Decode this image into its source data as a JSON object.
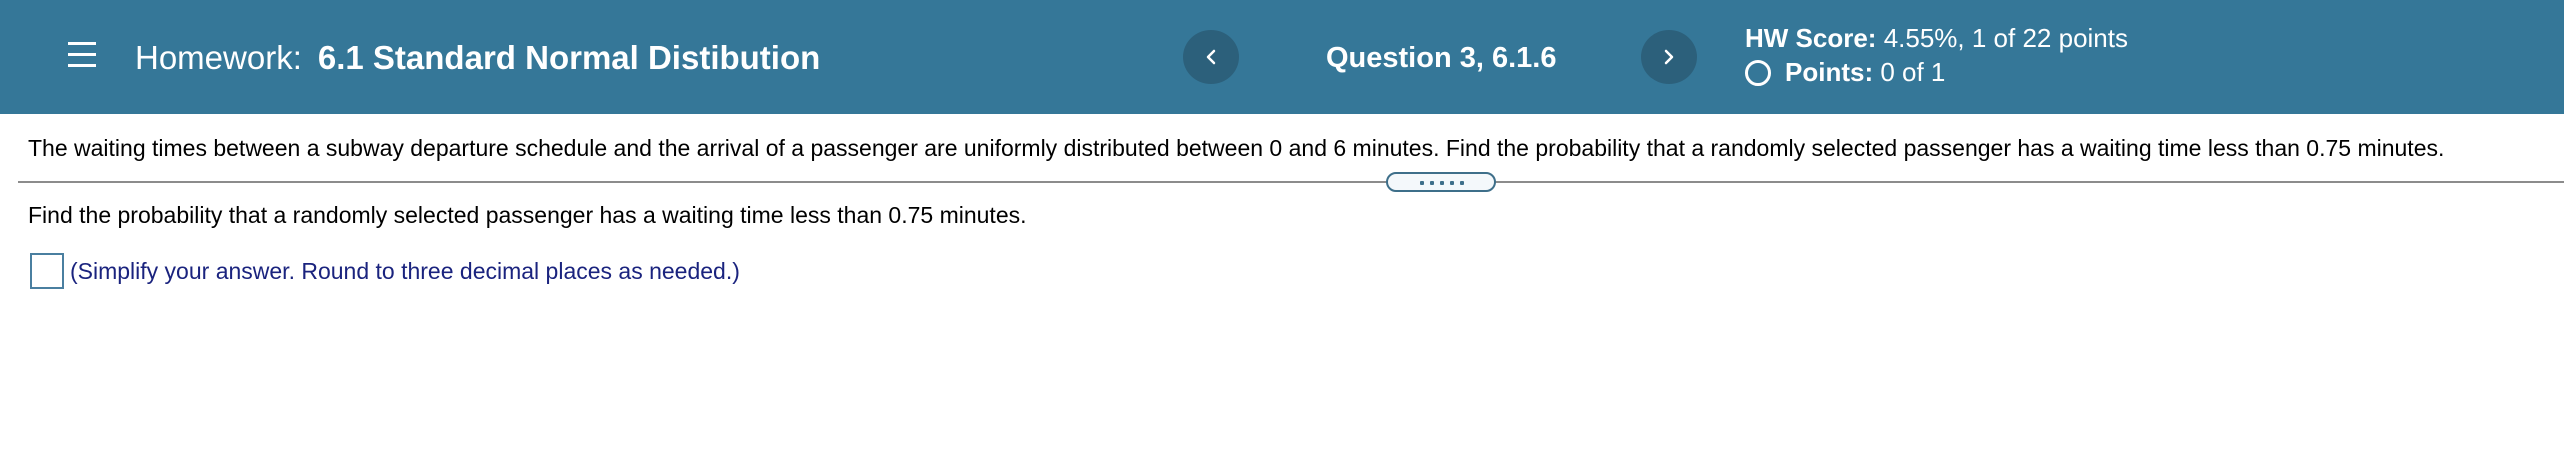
{
  "header": {
    "homework_prefix": "Homework:",
    "homework_name": "6.1 Standard Normal Distibution",
    "question_label": "Question 3, 6.1.6",
    "prev_icon": "chevron-left-icon",
    "next_icon": "chevron-right-icon",
    "menu_icon": "hamburger-menu-icon",
    "hw_score_label": "HW Score:",
    "hw_score_value": "4.55%, 1 of 22 points",
    "points_label": "Points:",
    "points_value": "0 of 1",
    "colors": {
      "bar_background": "#357798",
      "nav_button": "#2c607b"
    }
  },
  "problem": {
    "statement": "The waiting times between a subway departure schedule and the arrival of a passenger are uniformly distributed between 0 and 6 minutes. Find the probability that a randomly selected passenger has a waiting time less than 0.75 minutes."
  },
  "question": {
    "prompt": "Find the probability that a randomly selected passenger has a waiting time less than 0.75 minutes.",
    "answer_value": "",
    "answer_hint": "(Simplify your answer. Round to three decimal places as needed.)",
    "hint_color": "#1a237e"
  }
}
